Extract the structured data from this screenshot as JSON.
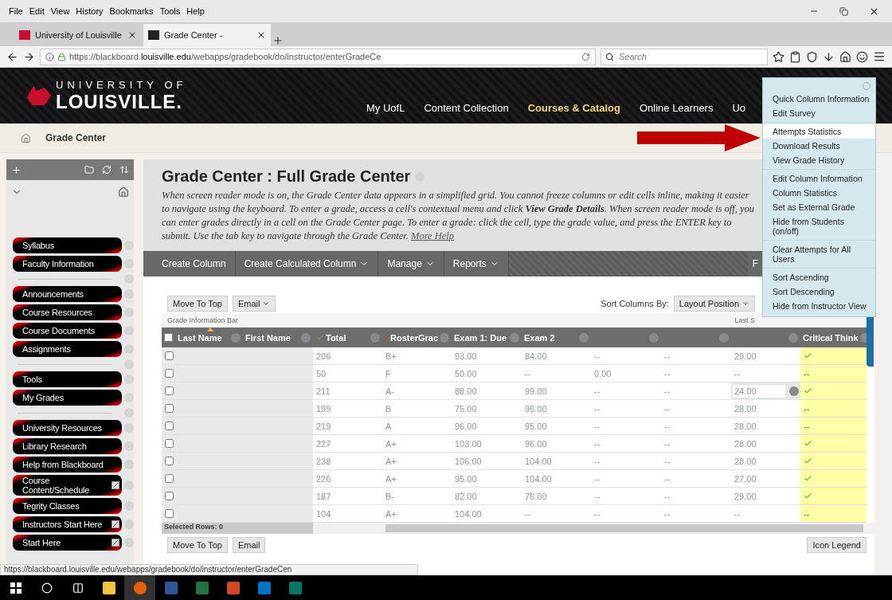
{
  "browser": {
    "menu": [
      "File",
      "Edit",
      "View",
      "History",
      "Bookmarks",
      "Tools",
      "Help"
    ],
    "tabs": [
      {
        "title": "University of Louisville",
        "selected": false
      },
      {
        "title": "Grade Center -",
        "selected": true
      }
    ],
    "url": "https://blackboard.**louisville.edu**/webapps/gradebook/do/instructor/enterGradeCe",
    "search_placeholder": "Search"
  },
  "header": {
    "logo_top": "UNIVERSITY OF",
    "logo_main": "LOUISVILLE.",
    "nav": [
      {
        "label": "My UofL",
        "selected": false
      },
      {
        "label": "Content Collection",
        "selected": false
      },
      {
        "label": "Courses & Catalog",
        "selected": true
      },
      {
        "label": "Online Learners",
        "selected": false
      },
      {
        "label": "Uo",
        "selected": false
      }
    ]
  },
  "breadcrumb": "Grade Center",
  "sidebar": {
    "items": [
      {
        "kind": "link",
        "label": "Syllabus",
        "external": false
      },
      {
        "kind": "link",
        "label": "Faculty Information",
        "external": false
      },
      {
        "kind": "divider"
      },
      {
        "kind": "link",
        "label": "Announcements",
        "external": false
      },
      {
        "kind": "link",
        "label": "Course Resources",
        "external": false
      },
      {
        "kind": "link",
        "label": "Course Documents",
        "external": false
      },
      {
        "kind": "link",
        "label": "Assignments",
        "external": false
      },
      {
        "kind": "divider"
      },
      {
        "kind": "link",
        "label": "Tools",
        "external": false
      },
      {
        "kind": "link",
        "label": "My Grades",
        "external": false
      },
      {
        "kind": "divider"
      },
      {
        "kind": "link",
        "label": "University Resources",
        "external": false
      },
      {
        "kind": "link",
        "label": "Library Research",
        "external": false
      },
      {
        "kind": "link",
        "label": "Help from Blackboard",
        "external": false
      },
      {
        "kind": "link",
        "label": "Course Content/Schedule",
        "external": true
      },
      {
        "kind": "link",
        "label": "Tegrity Classes",
        "external": false
      },
      {
        "kind": "link",
        "label": "Instructors Start Here",
        "external": true
      },
      {
        "kind": "link",
        "label": "Start Here",
        "external": true
      }
    ]
  },
  "page": {
    "title": "Grade Center : Full Grade Center",
    "description": "When screen reader mode is on, the Grade Center data appears in a simplified grid. You cannot freeze columns or edit cells inline, making it easier to navigate using the keyboard. To enter a grade, access a cell's contextual menu and click **View Grade Details**. When screen reader mode is off, you can enter grades directly in a cell on the Grade Center page. To enter a grade: click the cell, type the grade value, and press the ENTER key to submit. Use the tab key to navigate through the Grade Center.",
    "help_link": "More Help"
  },
  "action_bar": {
    "items": [
      {
        "label": "Create Column",
        "dropdown": false
      },
      {
        "label": "Create Calculated Column",
        "dropdown": true
      },
      {
        "label": "Manage",
        "dropdown": true
      },
      {
        "label": "Reports",
        "dropdown": true
      }
    ],
    "right_item": "F"
  },
  "toolbar": {
    "move_to_top": "Move To Top",
    "email": "Email",
    "sort_label": "Sort Columns By:",
    "sort_value": "Layout Position",
    "info_bar": "Grade Information Bar",
    "last_saved": "Last S"
  },
  "grid": {
    "select_all_checked": false,
    "columns": [
      {
        "label": "Last Name",
        "kind": "plain",
        "sorted": true
      },
      {
        "label": "First Name",
        "kind": "plain",
        "sorted": false
      },
      {
        "label": "Total",
        "kind": "calculated",
        "sorted": false
      },
      {
        "label": "RosterGrac",
        "kind": "manual",
        "sorted": false
      },
      {
        "label": "Exam 1: Due",
        "kind": "plain",
        "sorted": false
      },
      {
        "label": "Exam 2",
        "kind": "plain",
        "sorted": false
      },
      {
        "kind": "plain",
        "sorted": false
      },
      {
        "kind": "plain",
        "sorted": false
      },
      {
        "kind": "plain",
        "sorted": false
      },
      {
        "label": "Critical Think",
        "kind": "plain",
        "sorted": false
      }
    ],
    "rows": [
      {
        "checked": false,
        "editing": false,
        "cells": [
          "",
          "",
          "206",
          "B+",
          "93.00",
          "84.00",
          "--",
          "--",
          "29.00"
        ],
        "critical": {
          "kind": "check"
        }
      },
      {
        "checked": false,
        "editing": false,
        "cells": [
          "",
          "",
          "50",
          "F",
          "50.00",
          "--",
          "0.00",
          "--",
          "--"
        ],
        "critical": {
          "kind": "text",
          "text": "--"
        }
      },
      {
        "checked": false,
        "editing": true,
        "cells": [
          "",
          "",
          "211",
          "A-",
          "88.00",
          "99.00",
          "--",
          "--",
          "24.00"
        ],
        "critical": {
          "kind": "check"
        }
      },
      {
        "checked": false,
        "editing": false,
        "cells": [
          "",
          "",
          "199",
          "B",
          "75.00",
          "96.00",
          "--",
          "--",
          "28.00"
        ],
        "critical": {
          "kind": "text",
          "text": "--"
        }
      },
      {
        "checked": false,
        "editing": false,
        "cells": [
          "",
          "",
          "219",
          "A",
          "96.00",
          "95.00",
          "--",
          "--",
          "28.00"
        ],
        "critical": {
          "kind": "text",
          "text": "--"
        }
      },
      {
        "checked": false,
        "editing": false,
        "cells": [
          "",
          "",
          "227",
          "A+",
          "103.00",
          "96.00",
          "--",
          "--",
          "28.00"
        ],
        "critical": {
          "kind": "check"
        }
      },
      {
        "checked": false,
        "editing": false,
        "cells": [
          "",
          "",
          "238",
          "A+",
          "106.00",
          "104.00",
          "--",
          "--",
          "28.00"
        ],
        "critical": {
          "kind": "check"
        }
      },
      {
        "checked": false,
        "editing": false,
        "cells": [
          "",
          "",
          "226",
          "A+",
          "95.00",
          "104.00",
          "--",
          "--",
          "27.00"
        ],
        "critical": {
          "kind": "check"
        }
      },
      {
        "checked": false,
        "editing": false,
        "cells": [
          "",
          "",
          "187",
          "B-",
          "82.00",
          "76.00",
          "--",
          "--",
          "29.00"
        ],
        "critical": {
          "kind": "check"
        }
      },
      {
        "checked": false,
        "editing": false,
        "cells": [
          "",
          "",
          "104",
          "A+",
          "104.00",
          "--",
          "--",
          "--",
          "--"
        ],
        "critical": {
          "kind": "text",
          "text": "--"
        }
      }
    ],
    "selected_rows": "Selected Rows: 0"
  },
  "bottom_toolbar": {
    "move_to_top": "Move To Top",
    "email": "Email"
  },
  "icon_legend": "Icon Legend",
  "context_menu": {
    "groups": [
      [
        {
          "label": "Quick Column Information",
          "selected": false
        },
        {
          "label": "Edit Survey",
          "selected": false
        }
      ],
      [
        {
          "label": "Attempts Statistics",
          "selected": true
        },
        {
          "label": "Download Results",
          "selected": false
        },
        {
          "label": "View Grade History",
          "selected": false
        }
      ],
      [
        {
          "label": "Edit Column Information",
          "selected": false
        },
        {
          "label": "Column Statistics",
          "selected": false
        },
        {
          "label": "Set as External Grade",
          "selected": false
        },
        {
          "label": "Hide from Students (on/off)",
          "selected": false
        }
      ],
      [
        {
          "label": "Clear Attempts for All Users",
          "selected": false
        }
      ],
      [
        {
          "label": "Sort Ascending",
          "selected": false
        },
        {
          "label": "Sort Descending",
          "selected": false
        },
        {
          "label": "Hide from Instructor View",
          "selected": false
        }
      ]
    ]
  },
  "status_url": "https://blackboard.louisville.edu/webapps/gradebook/do/instructor/enterGradeCen"
}
